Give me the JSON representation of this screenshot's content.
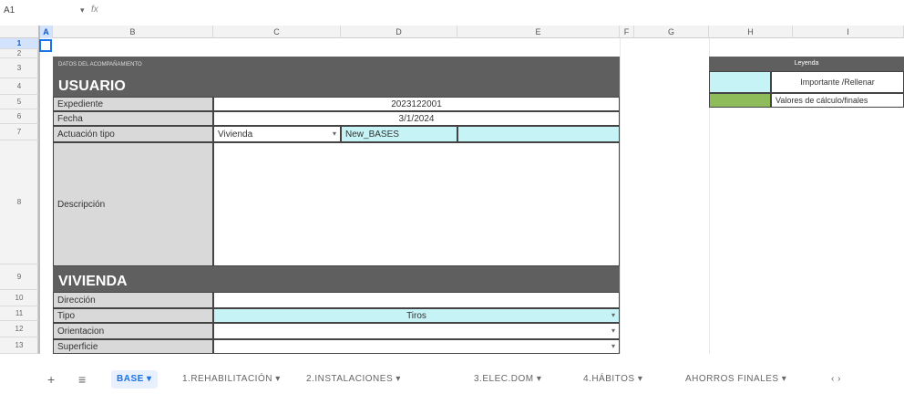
{
  "namebox": "A1",
  "formula_bar": "fx",
  "columns": [
    "A",
    "B",
    "C",
    "D",
    "E",
    "F",
    "G",
    "H",
    "I"
  ],
  "rows": [
    "1",
    "2",
    "3",
    "4",
    "5",
    "6",
    "7",
    "8",
    "9",
    "10",
    "11",
    "12",
    "13"
  ],
  "form": {
    "header_small": "DATOS DEL ACOMPAÑAMIENTO",
    "section1_title": "USUARIO",
    "expediente_label": "Expediente",
    "expediente_value": "2023122001",
    "fecha_label": "Fecha",
    "fecha_value": "3/1/2024",
    "actuacion_label": "Actuación tipo",
    "actuacion_value": "Vivienda",
    "actuacion_code": "New_BASES",
    "descripcion_label": "Descripción",
    "section2_title": "VIVIENDA",
    "direccion_label": "Dirección",
    "tipo_label": "Tipo",
    "tipo_value": "Tiros",
    "orientacion_label": "Orientacion",
    "superficie_label": "Superficie"
  },
  "legend": {
    "title": "Leyenda",
    "item1": "Importante /Rellenar",
    "item2": "Valores de cálculo/finales",
    "color1": "#c6f3f6",
    "color2": "#8ebc5a"
  },
  "tabs": {
    "add_icon": "+",
    "menu_icon": "≡",
    "items": [
      "BASE ▾",
      "1.REHABILITACIÓN ▾",
      "2.INSTALACIONES ▾",
      "3.ELEC.DOM ▾",
      "4.HÁBITOS ▾",
      "AHORROS FINALES ▾"
    ],
    "more": "‹ ›"
  }
}
